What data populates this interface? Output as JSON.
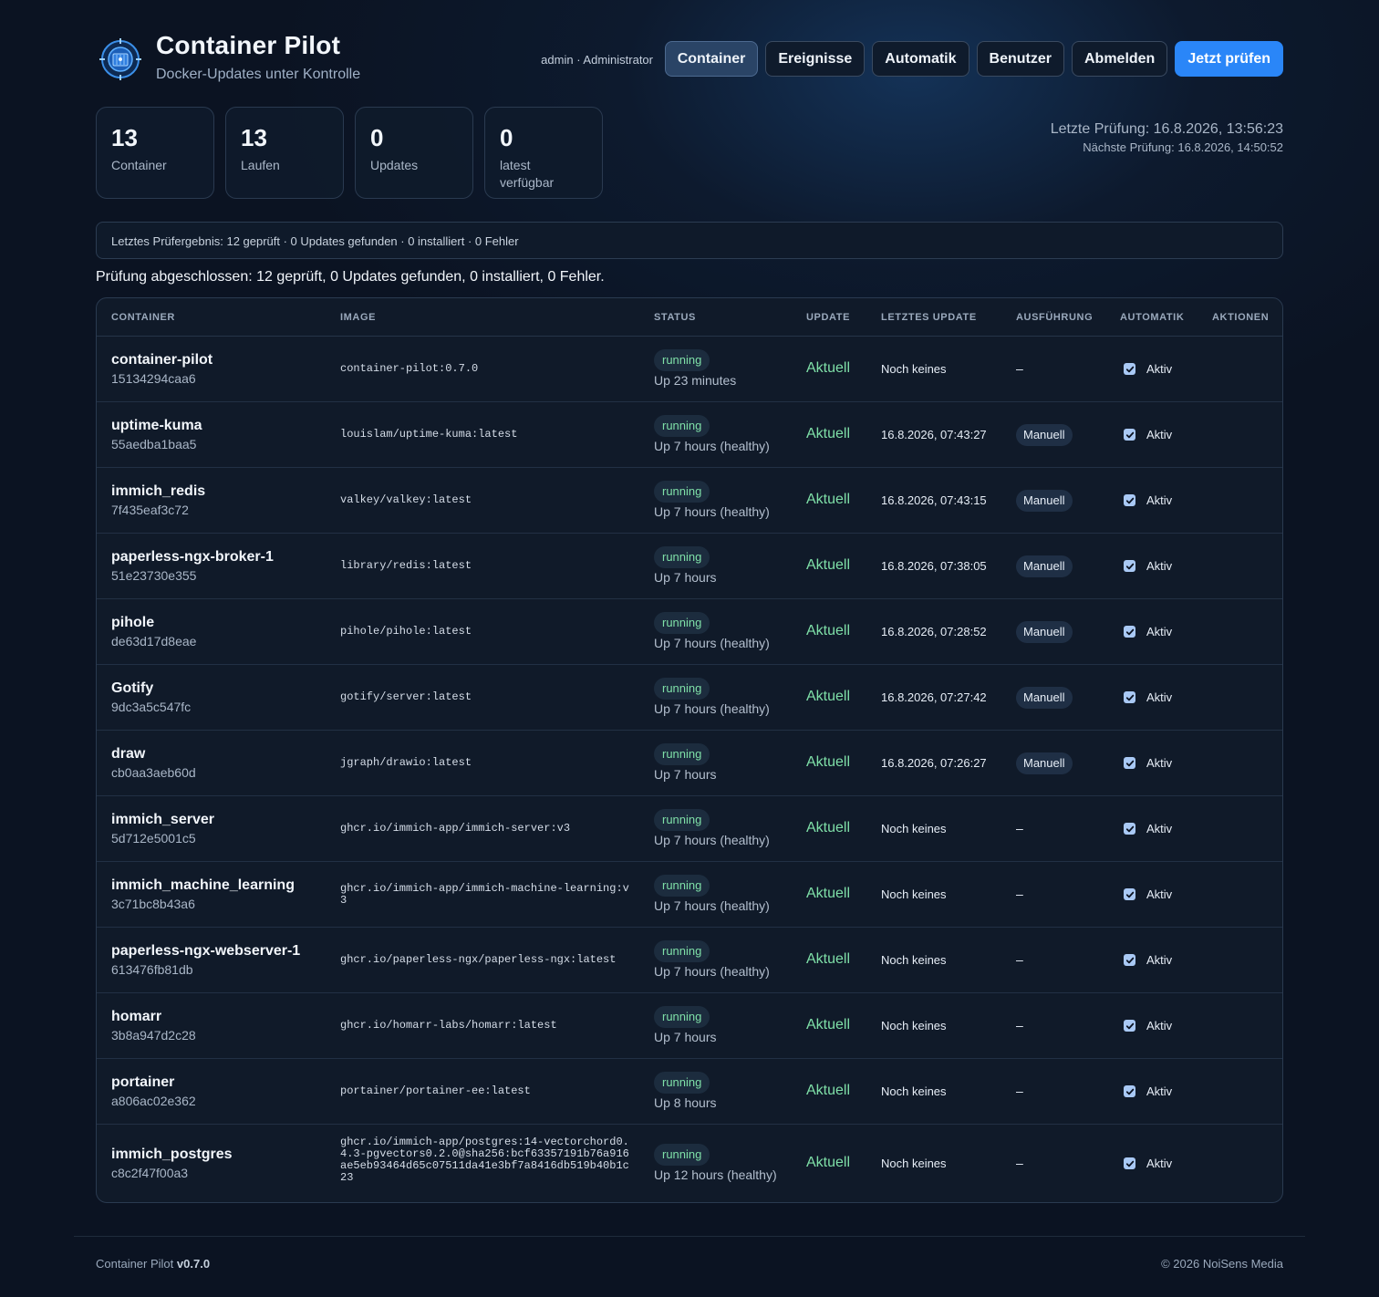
{
  "header": {
    "title": "Container Pilot",
    "subtitle": "Docker-Updates unter Kontrolle",
    "user": "admin · Administrator",
    "nav": {
      "container": "Container",
      "ereignisse": "Ereignisse",
      "automatik": "Automatik",
      "benutzer": "Benutzer",
      "abmelden": "Abmelden",
      "check_now": "Jetzt prüfen"
    }
  },
  "stats": [
    {
      "value": "13",
      "label": "Container"
    },
    {
      "value": "13",
      "label": "Laufen"
    },
    {
      "value": "0",
      "label": "Updates"
    },
    {
      "value": "0",
      "label": "latest verfügbar"
    }
  ],
  "checks": {
    "last": "Letzte Prüfung: 16.8.2026, 13:56:23",
    "next": "Nächste Prüfung: 16.8.2026, 14:50:52"
  },
  "result_bar": "Letztes Prüfergebnis: 12 geprüft · 0 Updates gefunden · 0 installiert · 0 Fehler",
  "result_message": "Prüfung abgeschlossen: 12 geprüft, 0 Updates gefunden, 0 installiert, 0 Fehler.",
  "table": {
    "headers": {
      "container": "CONTAINER",
      "image": "IMAGE",
      "status": "STATUS",
      "update": "UPDATE",
      "last_update": "LETZTES UPDATE",
      "execution": "AUSFÜHRUNG",
      "automatic": "AUTOMATIK",
      "actions": "AKTIONEN"
    },
    "rows": [
      {
        "name": "container-pilot",
        "id": "15134294caa6",
        "image": "container-pilot:0.7.0",
        "status": "running",
        "uptime": "Up 23 minutes",
        "update": "Aktuell",
        "last_update": "Noch keines",
        "execution": "–",
        "automatic": "Aktiv"
      },
      {
        "name": "uptime-kuma",
        "id": "55aedba1baa5",
        "image": "louislam/uptime-kuma:latest",
        "status": "running",
        "uptime": "Up 7 hours (healthy)",
        "update": "Aktuell",
        "last_update": "16.8.2026, 07:43:27",
        "execution": "Manuell",
        "automatic": "Aktiv"
      },
      {
        "name": "immich_redis",
        "id": "7f435eaf3c72",
        "image": "valkey/valkey:latest",
        "status": "running",
        "uptime": "Up 7 hours (healthy)",
        "update": "Aktuell",
        "last_update": "16.8.2026, 07:43:15",
        "execution": "Manuell",
        "automatic": "Aktiv"
      },
      {
        "name": "paperless-ngx-broker-1",
        "id": "51e23730e355",
        "image": "library/redis:latest",
        "status": "running",
        "uptime": "Up 7 hours",
        "update": "Aktuell",
        "last_update": "16.8.2026, 07:38:05",
        "execution": "Manuell",
        "automatic": "Aktiv"
      },
      {
        "name": "pihole",
        "id": "de63d17d8eae",
        "image": "pihole/pihole:latest",
        "status": "running",
        "uptime": "Up 7 hours (healthy)",
        "update": "Aktuell",
        "last_update": "16.8.2026, 07:28:52",
        "execution": "Manuell",
        "automatic": "Aktiv"
      },
      {
        "name": "Gotify",
        "id": "9dc3a5c547fc",
        "image": "gotify/server:latest",
        "status": "running",
        "uptime": "Up 7 hours (healthy)",
        "update": "Aktuell",
        "last_update": "16.8.2026, 07:27:42",
        "execution": "Manuell",
        "automatic": "Aktiv"
      },
      {
        "name": "draw",
        "id": "cb0aa3aeb60d",
        "image": "jgraph/drawio:latest",
        "status": "running",
        "uptime": "Up 7 hours",
        "update": "Aktuell",
        "last_update": "16.8.2026, 07:26:27",
        "execution": "Manuell",
        "automatic": "Aktiv"
      },
      {
        "name": "immich_server",
        "id": "5d712e5001c5",
        "image": "ghcr.io/immich-app/immich-server:v3",
        "status": "running",
        "uptime": "Up 7 hours (healthy)",
        "update": "Aktuell",
        "last_update": "Noch keines",
        "execution": "–",
        "automatic": "Aktiv"
      },
      {
        "name": "immich_machine_learning",
        "id": "3c71bc8b43a6",
        "image": "ghcr.io/immich-app/immich-machine-learning:v3",
        "status": "running",
        "uptime": "Up 7 hours (healthy)",
        "update": "Aktuell",
        "last_update": "Noch keines",
        "execution": "–",
        "automatic": "Aktiv"
      },
      {
        "name": "paperless-ngx-webserver-1",
        "id": "613476fb81db",
        "image": "ghcr.io/paperless-ngx/paperless-ngx:latest",
        "status": "running",
        "uptime": "Up 7 hours (healthy)",
        "update": "Aktuell",
        "last_update": "Noch keines",
        "execution": "–",
        "automatic": "Aktiv"
      },
      {
        "name": "homarr",
        "id": "3b8a947d2c28",
        "image": "ghcr.io/homarr-labs/homarr:latest",
        "status": "running",
        "uptime": "Up 7 hours",
        "update": "Aktuell",
        "last_update": "Noch keines",
        "execution": "–",
        "automatic": "Aktiv"
      },
      {
        "name": "portainer",
        "id": "a806ac02e362",
        "image": "portainer/portainer-ee:latest",
        "status": "running",
        "uptime": "Up 8 hours",
        "update": "Aktuell",
        "last_update": "Noch keines",
        "execution": "–",
        "automatic": "Aktiv"
      },
      {
        "name": "immich_postgres",
        "id": "c8c2f47f00a3",
        "image": "ghcr.io/immich-app/postgres:14-vectorchord0.4.3-pgvectors0.2.0@sha256:bcf63357191b76a916ae5eb93464d65c07511da41e3bf7a8416db519b40b1c23",
        "status": "running",
        "uptime": "Up 12 hours (healthy)",
        "update": "Aktuell",
        "last_update": "Noch keines",
        "execution": "–",
        "automatic": "Aktiv"
      }
    ]
  },
  "footer": {
    "app": "Container Pilot",
    "version": "v0.7.0",
    "copyright": "© 2026 NoiSens Media"
  },
  "colors": {
    "accent": "#2a86f8",
    "ok": "#7fe0a8",
    "background": "#0b1322"
  }
}
